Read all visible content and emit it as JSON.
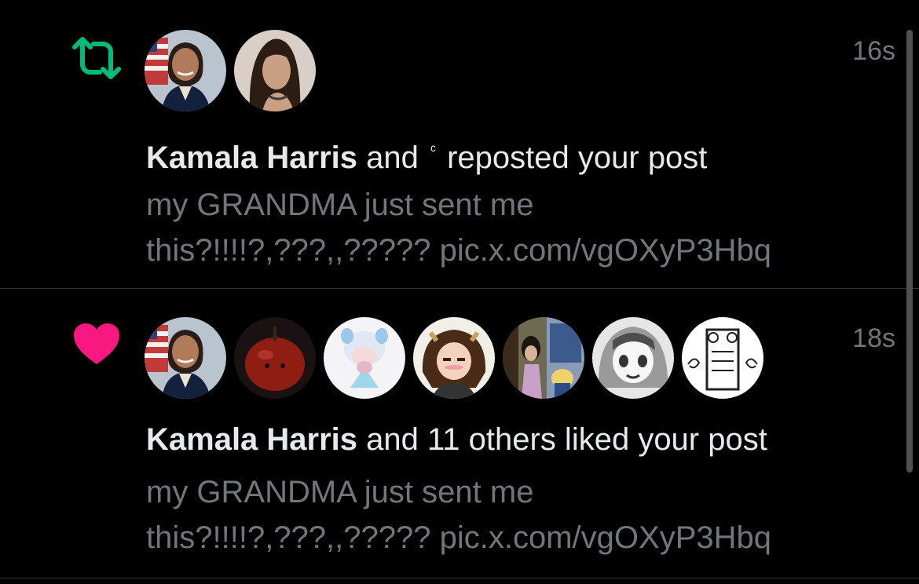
{
  "colors": {
    "background": "#000000",
    "repost_green": "#00ba7c",
    "like_pink": "#f91880",
    "primary_text": "#e7e9ea",
    "secondary_text": "#71767b",
    "divider": "#2f3336"
  },
  "notifications": [
    {
      "type": "repost",
      "icon": "repost-icon",
      "timestamp": "16s",
      "avatars": [
        "kamala-harris-avatar",
        "ariana-avatar"
      ],
      "headline": {
        "name": "Kamala Harris",
        "and": " and ",
        "second_name": "ᶜ",
        "action": "reposted your post"
      },
      "preview_line1": "my GRANDMA just sent me",
      "preview_line2": "this?!!!!?,???,,????? pic.x.com/vgOXyP3Hbq"
    },
    {
      "type": "like",
      "icon": "heart-icon",
      "timestamp": "18s",
      "avatars": [
        "kamala-harris-avatar",
        "apple-avatar",
        "plush-avatar",
        "anime-boy-avatar",
        "room-photo-avatar",
        "manga-girl-avatar",
        "sketch-avatar"
      ],
      "headline": {
        "name": "Kamala Harris",
        "rest": " and 11 others liked your post"
      },
      "preview_line1": "my GRANDMA just sent me",
      "preview_line2": "this?!!!!?,???,,????? pic.x.com/vgOXyP3Hbq"
    }
  ]
}
